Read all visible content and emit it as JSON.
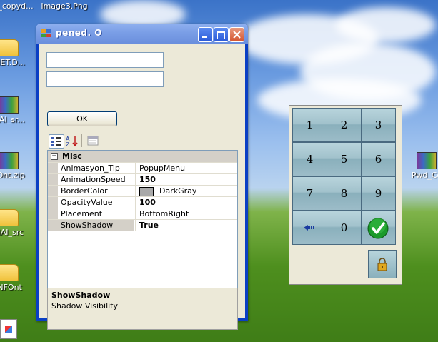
{
  "desktop_icons": [
    {
      "label": "_copyd...",
      "icon": "file-icon"
    },
    {
      "label": "Image3.Png",
      "icon": "image-file-icon"
    },
    {
      "label": ".NET.D...",
      "icon": "folder-icon"
    },
    {
      "label": "alAI_sr...",
      "icon": "rar-archive-icon"
    },
    {
      "label": "FOnt.zip",
      "icon": "rar-archive-icon"
    },
    {
      "label": "alAI_src",
      "icon": "folder-icon"
    },
    {
      "label": "INFOnt",
      "icon": "folder-icon"
    },
    {
      "label": "Pwd_Co",
      "icon": "rar-archive-icon"
    }
  ],
  "window": {
    "title": "pened.   O",
    "ok_label": "OK",
    "textbox1_value": "",
    "textbox2_value": ""
  },
  "toolbar": {
    "categorized_icon": "categorized-view-icon",
    "alphabetical_icon": "alphabetical-sort-icon",
    "property_pages_icon": "property-pages-icon"
  },
  "property_grid": {
    "category": "Misc",
    "rows": [
      {
        "name": "Animasyon_Tip",
        "value": "PopupMenu",
        "bold": false
      },
      {
        "name": "AnimationSpeed",
        "value": "150",
        "bold": true
      },
      {
        "name": "BorderColor",
        "value": "DarkGray",
        "bold": false,
        "swatch": "#a9a9a9"
      },
      {
        "name": "OpacityValue",
        "value": "100",
        "bold": true
      },
      {
        "name": "Placement",
        "value": "BottomRight",
        "bold": false
      },
      {
        "name": "ShowShadow",
        "value": "True",
        "bold": true
      }
    ],
    "selected": "ShowShadow"
  },
  "description": {
    "title": "ShowShadow",
    "text": "Shadow Visibility"
  },
  "keypad": {
    "keys": [
      "1",
      "2",
      "3",
      "4",
      "5",
      "6",
      "7",
      "8",
      "9",
      "",
      "0",
      ""
    ],
    "backspace_icon": "backspace-arrow-icon",
    "ok_icon": "checkmark-icon",
    "lock_icon": "padlock-icon"
  },
  "colors": {
    "title_bar": "#7a9ee6",
    "frame": "#0a3fc4",
    "face": "#ece9d8",
    "key": "#a2c2cc",
    "check": "#1a9a2a"
  }
}
